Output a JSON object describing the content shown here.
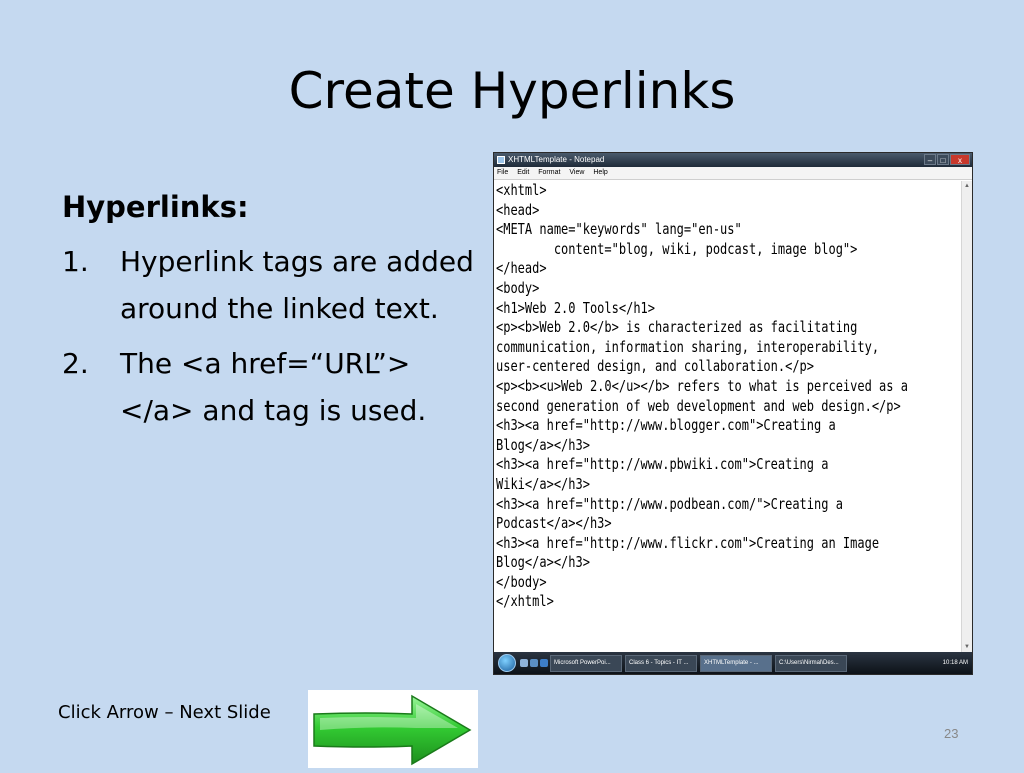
{
  "slide": {
    "title": "Create Hyperlinks",
    "section_heading": "Hyperlinks:",
    "items": [
      {
        "num": "1.",
        "text": "Hyperlink tags are added around the linked text."
      },
      {
        "num": "2.",
        "text": "The <a href=“URL”></a>  and tag is used."
      }
    ],
    "footer_text": "Click Arrow – Next Slide",
    "page_number": "23"
  },
  "notepad": {
    "window_title": "XHTMLTemplate - Notepad",
    "menu": [
      "File",
      "Edit",
      "Format",
      "View",
      "Help"
    ],
    "window_controls": {
      "minimize": "–",
      "maximize": "□",
      "close": "x"
    },
    "content": "<xhtml>\n<head>\n<META name=\"keywords\" lang=\"en-us\"\n        content=\"blog, wiki, podcast, image blog\">\n</head>\n<body>\n<h1>Web 2.0 Tools</h1>\n<p><b>Web 2.0</b> is characterized as facilitating\ncommunication, information sharing, interoperability,\nuser-centered design, and collaboration.</p>\n<p><b><u>Web 2.0</u></b> refers to what is perceived as a\nsecond generation of web development and web design.</p>\n<h3><a href=\"http://www.blogger.com\">Creating a\nBlog</a></h3>\n<h3><a href=\"http://www.pbwiki.com\">Creating a\nWiki</a></h3>\n<h3><a href=\"http://www.podbean.com/\">Creating a\nPodcast</a></h3>\n<h3><a href=\"http://www.flickr.com\">Creating an Image\nBlog</a></h3>\n</body>\n</xhtml>"
  },
  "taskbar": {
    "buttons": [
      {
        "label": "Microsoft PowerPoi...",
        "active": false
      },
      {
        "label": "Class 6 - Topics - IT ...",
        "active": false
      },
      {
        "label": "XHTMLTemplate - ...",
        "active": true
      },
      {
        "label": "C:\\Users\\Nirmal\\Des...",
        "active": false
      }
    ],
    "clock": "10:18 AM"
  },
  "colors": {
    "slide_background": "#c5d9f0",
    "arrow_green": "#33cc33",
    "titlebar": "#1e2a38"
  },
  "icons": {
    "next_arrow": "right-arrow-icon",
    "start": "windows-start-icon"
  }
}
